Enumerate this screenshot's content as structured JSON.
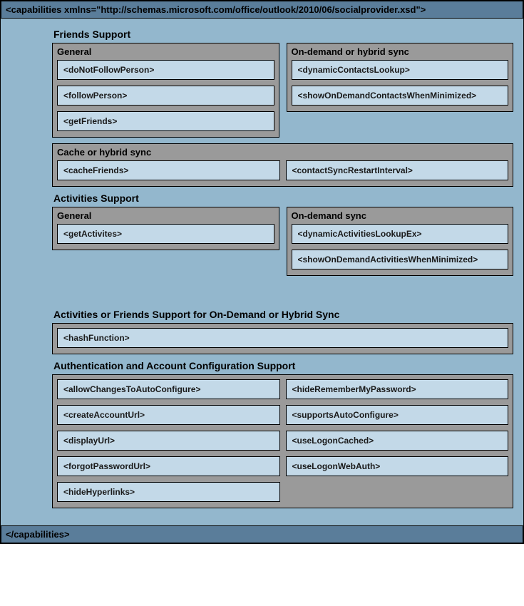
{
  "header": "<capabilities xmlns=\"http://schemas.microsoft.com/office/outlook/2010/06/socialprovider.xsd\">",
  "footer": "</capabilities>",
  "sections": {
    "friends": {
      "title": "Friends Support",
      "general": {
        "title": "General",
        "items": [
          "<doNotFollowPerson>",
          "<followPerson>",
          "<getFriends>"
        ]
      },
      "ondemand": {
        "title": "On-demand or hybrid sync",
        "items": [
          "<dynamicContactsLookup>",
          "<showOnDemandContactsWhenMinimized>"
        ]
      },
      "cache": {
        "title": "Cache or hybrid sync",
        "left": "<cacheFriends>",
        "right": "<contactSyncRestartInterval>"
      }
    },
    "activities": {
      "title": "Activities Support",
      "general": {
        "title": "General",
        "items": [
          "<getActivites>"
        ]
      },
      "ondemand": {
        "title": "On-demand sync",
        "items": [
          "<dynamicActivitiesLookupEx>",
          "<showOnDemandActivitiesWhenMinimized>"
        ]
      }
    },
    "hybrid": {
      "title": "Activities or Friends Support for On-Demand or Hybrid Sync",
      "items": [
        "<hashFunction>"
      ]
    },
    "auth": {
      "title": "Authentication and Account Configuration Support",
      "left": [
        "<allowChangesToAutoConfigure>",
        "<createAccountUrl>",
        "<displayUrl>",
        "<forgotPasswordUrl>",
        "<hideHyperlinks>"
      ],
      "right": [
        "<hideRememberMyPassword>",
        "<supportsAutoConfigure>",
        "<useLogonCached>",
        "<useLogonWebAuth>"
      ]
    }
  }
}
